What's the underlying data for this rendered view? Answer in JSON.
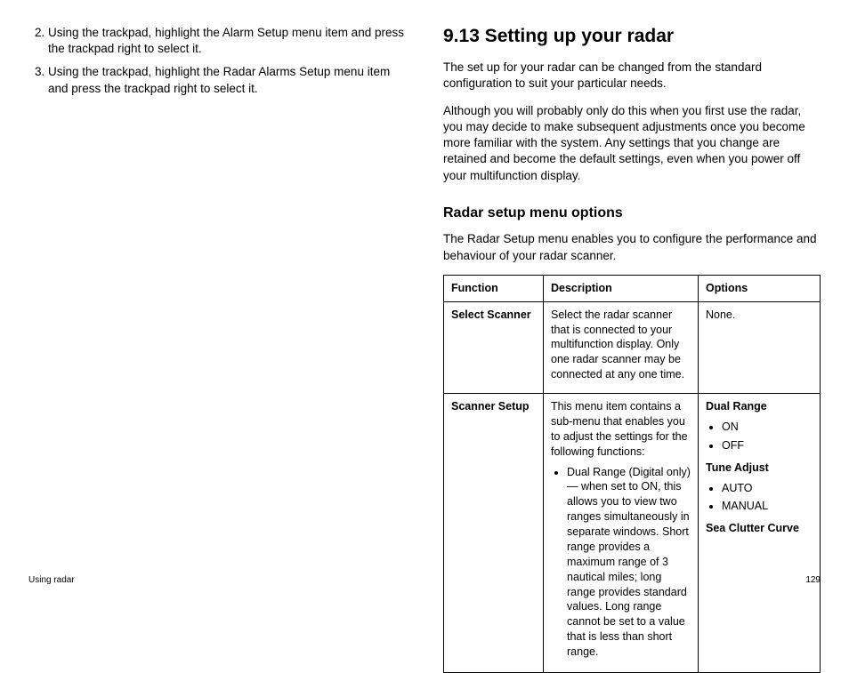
{
  "left": {
    "list_start": 2,
    "steps": [
      "Using the trackpad, highlight the Alarm Setup menu item and press the trackpad right to select it.",
      "Using the trackpad, highlight the Radar Alarms Setup menu item and press the trackpad right to select it."
    ]
  },
  "right": {
    "heading": "9.13 Setting up your radar",
    "para1": "The set up for your radar can be changed from the standard configuration to suit your particular needs.",
    "para2": "Although you will probably only do this when you first use the radar, you may decide to make subsequent adjustments once you become more familiar with the system. Any settings that you change are retained and become the default settings, even when you power off your multifunction display.",
    "subhead": "Radar setup menu options",
    "para3": "The Radar Setup menu enables you to configure the performance and behaviour of your radar scanner.",
    "table": {
      "headers": {
        "c1": "Function",
        "c2": "Description",
        "c3": "Options"
      },
      "rows": [
        {
          "fn": "Select Scanner",
          "desc_text": "Select the radar scanner that is connected to your multifunction display. Only one radar scanner may be connected at any one time.",
          "opts_plain": "None."
        },
        {
          "fn": "Scanner Setup",
          "desc_text": "This menu item contains a sub-menu that enables you to adjust the settings for the following functions:",
          "desc_bullets": [
            "Dual Range (Digital only) — when set to ON, this allows you to view two ranges simultaneously in separate windows. Short range provides a maximum range of 3 nautical miles; long range provides standard values. Long range cannot be set to a value that is less than short range."
          ],
          "opts_groups": [
            {
              "label": "Dual Range",
              "items": [
                "ON",
                "OFF"
              ]
            },
            {
              "label": "Tune Adjust",
              "items": [
                "AUTO",
                "MANUAL"
              ]
            },
            {
              "label": "Sea Clutter Curve",
              "items": []
            }
          ]
        }
      ]
    }
  },
  "footer": {
    "left": "Using radar",
    "right": "129"
  }
}
